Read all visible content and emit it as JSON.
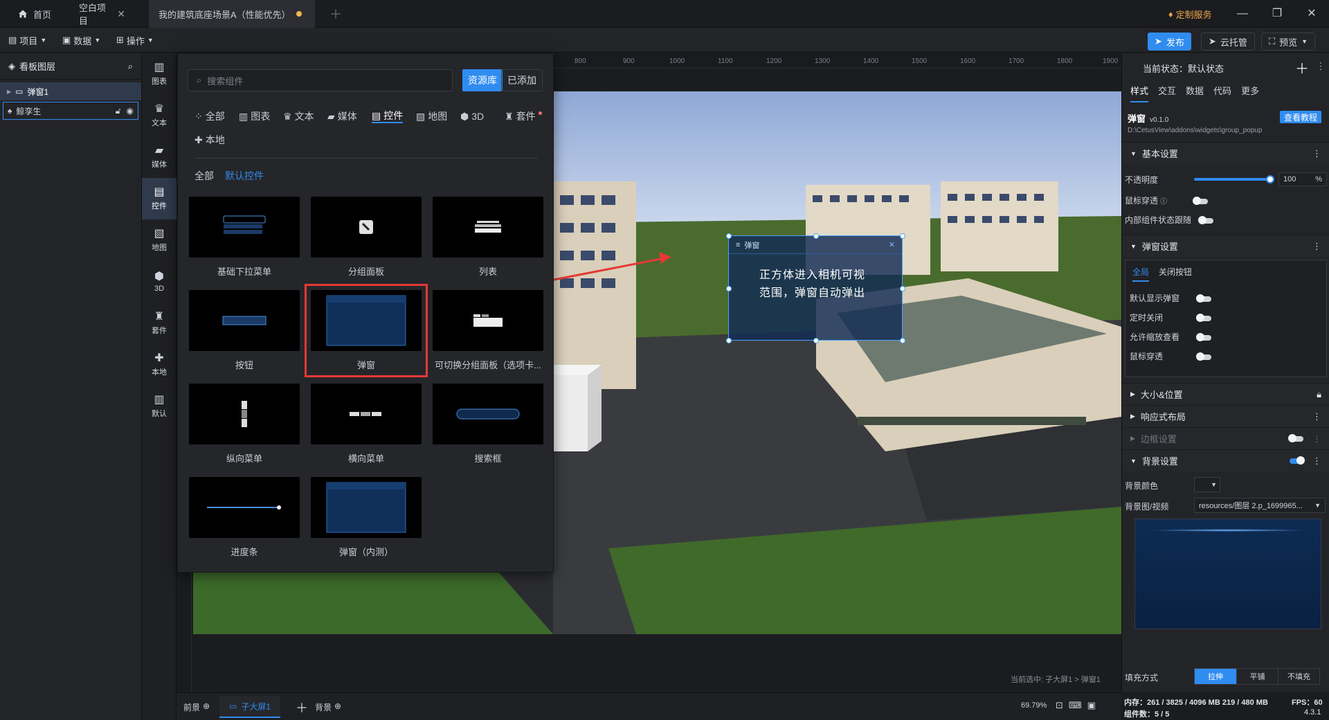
{
  "tabs": [
    {
      "label": "首页",
      "icon": "home-icon"
    },
    {
      "label": "空白项目",
      "closable": true
    },
    {
      "label": "我的建筑底座场景A（性能优先）",
      "unsaved": true
    }
  ],
  "titlebar": {
    "custom_service": "定制服务"
  },
  "menubar": {
    "items": [
      {
        "label": "项目"
      },
      {
        "label": "数据"
      },
      {
        "label": "操作"
      }
    ],
    "publish": "发布",
    "cloud": "云托管",
    "preview": "预览"
  },
  "layers": {
    "title": "看板图层",
    "items": [
      {
        "label": "弹窗1"
      },
      {
        "label": "鲸孪生"
      }
    ]
  },
  "iconbar": [
    {
      "label": "图表",
      "icon": "chart-icon"
    },
    {
      "label": "文本",
      "icon": "text-icon"
    },
    {
      "label": "媒体",
      "icon": "media-icon"
    },
    {
      "label": "控件",
      "icon": "widget-icon"
    },
    {
      "label": "地图",
      "icon": "map-icon"
    },
    {
      "label": "3D",
      "icon": "cube-icon"
    },
    {
      "label": "套件",
      "icon": "kit-icon"
    },
    {
      "label": "本地",
      "icon": "puzzle-icon"
    },
    {
      "label": "默认",
      "icon": "chart-icon"
    }
  ],
  "library": {
    "search_placeholder": "搜索组件",
    "btn_library": "资源库",
    "btn_added": "已添加",
    "categories": [
      "全部",
      "图表",
      "文本",
      "媒体",
      "控件",
      "地图",
      "3D",
      "套件",
      "本地"
    ],
    "subcats": [
      "全部",
      "默认控件"
    ],
    "cards": [
      {
        "label": "基础下拉菜单"
      },
      {
        "label": "分组面板"
      },
      {
        "label": "列表"
      },
      {
        "label": "按钮"
      },
      {
        "label": "弹窗"
      },
      {
        "label": "可切换分组面板（选项卡..."
      },
      {
        "label": "纵向菜单"
      },
      {
        "label": "横向菜单"
      },
      {
        "label": "搜索框"
      },
      {
        "label": "进度条"
      },
      {
        "label": "弹窗（内测）"
      }
    ]
  },
  "ruler": {
    "ticks": [
      "800",
      "900",
      "1000",
      "1100",
      "1200",
      "1300",
      "1400",
      "1500",
      "1600",
      "1700",
      "1800",
      "1900"
    ]
  },
  "scene": {
    "popup_title": "弹窗",
    "annotation": "正方体进入相机可视范围，弹窗自动弹出",
    "current_selection": "当前选中: 子大屏1 > 弹窗1"
  },
  "bottombar": {
    "front": "前景",
    "screen_tab": "子大屏1",
    "back": "背景",
    "zoom": "69.79%"
  },
  "rightpanel": {
    "state": "当前状态：默认状态",
    "tabs": [
      "样式",
      "交互",
      "数据",
      "代码",
      "更多"
    ],
    "component_name": "弹窗",
    "version": "v0.1.0",
    "tutorial": "查看教程",
    "path": "D:\\CetusView\\addons\\widgets\\group_popup",
    "sections": {
      "basic": "基本设置",
      "popup": "弹窗设置",
      "size": "大小&位置",
      "responsive": "响应式布局",
      "border": "边框设置",
      "background": "背景设置"
    },
    "opacity_label": "不透明度",
    "opacity_value": "100",
    "opacity_unit": "%",
    "mouse_through": "鼠标穿透",
    "inner_follow": "内部组件状态跟随",
    "popup_tabs": [
      "全局",
      "关闭按钮"
    ],
    "popup_toggles": [
      "默认显示弹窗",
      "定时关闭",
      "允许缩放查看",
      "鼠标穿透"
    ],
    "bg_color": "背景颜色",
    "bg_image": "背景图/视频",
    "bg_image_value": "resources/图层 2.p_1699965...",
    "fill_mode": "填充方式",
    "fill_options": [
      "拉伸",
      "平铺",
      "不填充"
    ],
    "opacity_level": 1.0
  },
  "status": {
    "memory": "内存：261 / 3825 / 4096 MB  219 / 480 MB",
    "fps": "FPS：60",
    "components": "组件数：5 / 5",
    "version": "4.3.1"
  }
}
